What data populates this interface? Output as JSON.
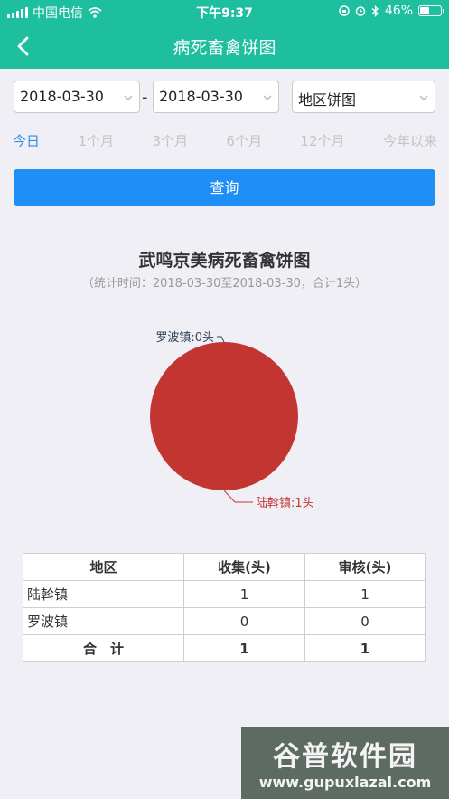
{
  "status_bar": {
    "carrier": "中国电信",
    "time": "下午9:37",
    "battery": "46%"
  },
  "nav": {
    "title": "病死畜禽饼图"
  },
  "filters": {
    "start_date": "2018-03-30",
    "separator": "-",
    "end_date": "2018-03-30",
    "chart_type": "地区饼图"
  },
  "quick_ranges": [
    {
      "label": "今日",
      "active": true
    },
    {
      "label": "1个月",
      "active": false
    },
    {
      "label": "3个月",
      "active": false
    },
    {
      "label": "6个月",
      "active": false
    },
    {
      "label": "12个月",
      "active": false
    },
    {
      "label": "今年以来",
      "active": false
    }
  ],
  "query_button": "查询",
  "chart": {
    "title": "武鸣京美病死畜禽饼图",
    "subtitle": "（统计时间：2018-03-30至2018-03-30，合计1头）"
  },
  "chart_data": {
    "type": "pie",
    "title": "武鸣京美病死畜禽饼图",
    "subtitle": "（统计时间：2018-03-30至2018-03-30，合计1头）",
    "slices": [
      {
        "label": "陆斡镇:1头",
        "name": "陆斡镇",
        "value": 1,
        "color": "#c23531"
      },
      {
        "label": "罗波镇:0头",
        "name": "罗波镇",
        "value": 0,
        "color": "#2f4554"
      }
    ]
  },
  "table": {
    "headers": [
      "地区",
      "收集(头)",
      "审核(头)"
    ],
    "rows": [
      {
        "region": "陆斡镇",
        "collected": "1",
        "reviewed": "1"
      },
      {
        "region": "罗波镇",
        "collected": "0",
        "reviewed": "0"
      }
    ],
    "total": {
      "label": "合　计",
      "collected": "1",
      "reviewed": "1"
    }
  },
  "watermark": {
    "title": "谷普软件园",
    "url": "www.gupuxlazal.com"
  },
  "colors": {
    "primary": "#1dbf9f",
    "button": "#1f8ff7",
    "active_tab": "#2f8fe8",
    "pie_red": "#c23531",
    "label_dark": "#2f4554"
  }
}
